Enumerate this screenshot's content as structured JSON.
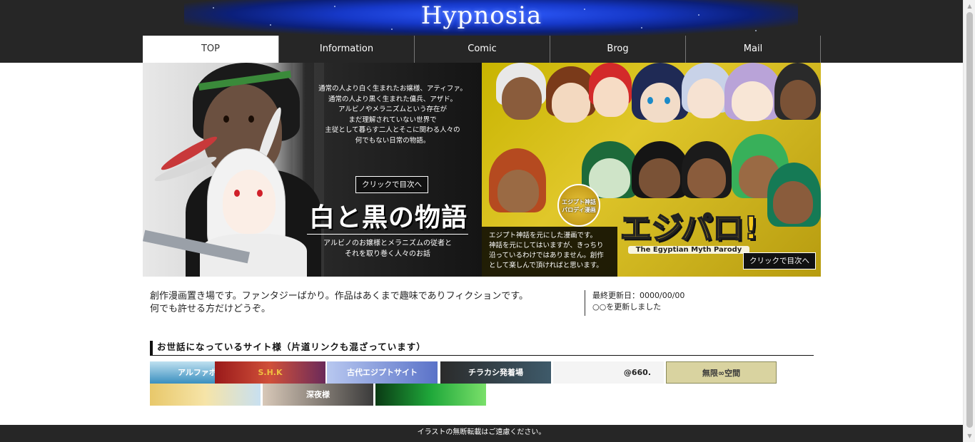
{
  "header": {
    "title": "Hypnosia"
  },
  "nav": {
    "items": [
      {
        "label": "TOP",
        "active": true
      },
      {
        "label": "Information",
        "active": false
      },
      {
        "label": "Comic",
        "active": false
      },
      {
        "label": "Brog",
        "active": false
      },
      {
        "label": "Mail",
        "active": false
      }
    ]
  },
  "hero": {
    "left": {
      "story": "通常の人より白く生まれたお嬢様、アティファ。\n通常の人より黒く生まれた傭兵、アザド。\nアルビノやメラニズムという存在が\nまだ理解されていない世界で\n主従として暮らす二人とそこに関わる人々の\n何でもない日常の物語。",
      "toc_label": "クリックで目次へ",
      "title": "白と黒の物語",
      "subtitle": "アルビノのお嬢様とメラニズムの従者と\nそれを取り巻く人々のお話"
    },
    "right": {
      "badge": "エジプト神話\nパロディ漫画",
      "logo": "エジパロ!",
      "logo_sub": "The Egyptian Myth Parody",
      "description": "エジプト神話を元にした漫画です。\n神話を元にしてはいますが、きっちり\n沿っているわけではありません。創作\nとして楽しんで頂ければと思います。",
      "toc_label": "クリックで目次へ"
    }
  },
  "intro": {
    "line1": "創作漫画置き場です。ファンタジーばかり。作品はあくまで趣味でありフィクションです。",
    "line2": "何でも許せる方だけどうぞ。"
  },
  "update": {
    "date_label": "最終更新日：0000/00/00",
    "note": "○○を更新しました"
  },
  "links": {
    "heading": "お世話になっているサイト様（片道リンクも混ざっています）",
    "banners": [
      {
        "label": "アルファポリス",
        "bg": "#3a8fbf",
        "fg": "#ffffff"
      },
      {
        "label": "S.H.K",
        "bg": "#9a1a1a",
        "fg": "#f0c040"
      },
      {
        "label": "古代エジプトサイト",
        "bg": "#5a72c8",
        "fg": "#ffffff"
      },
      {
        "label": "チラカシ発着場",
        "bg": "#2b2b2b",
        "fg": "#ffffff"
      },
      {
        "label": "@660.",
        "bg": "#f4f4f4",
        "fg": "#222222"
      },
      {
        "label": "無限∞空間",
        "bg": "#d9d3a0",
        "fg": "#3a3a3a"
      },
      {
        "label": "",
        "bg": "#e8c86a",
        "fg": "#333333"
      },
      {
        "label": "深夜様",
        "bg": "#3b3b3b",
        "fg": "#ffffff"
      },
      {
        "label": "",
        "bg": "#1fa83a",
        "fg": "#ffffff"
      }
    ]
  },
  "footer": {
    "text": "イラストの無断転載はご遠慮ください。"
  }
}
